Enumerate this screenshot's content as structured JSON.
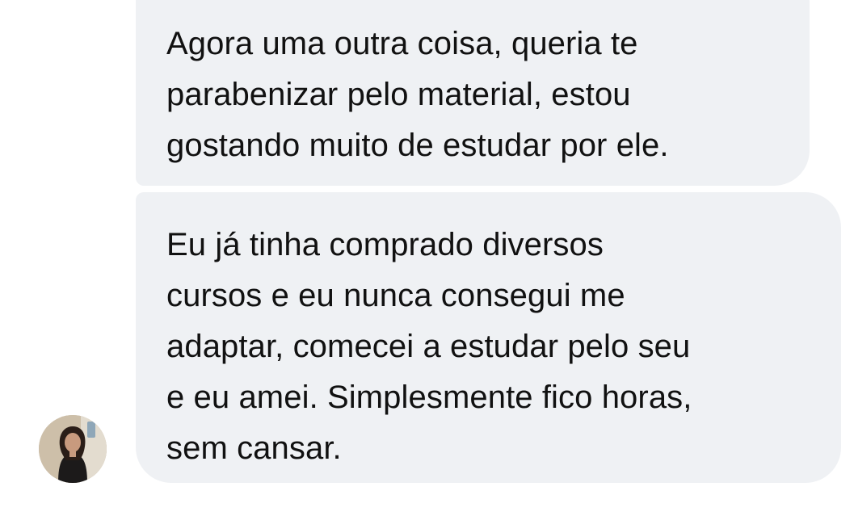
{
  "thread": {
    "messages": [
      {
        "sender": "contact",
        "text": "Agora uma outra coisa, queria te\nparabenizar pelo material, estou\ngostando muito de estudar por ele."
      },
      {
        "sender": "contact",
        "text": "Eu já tinha comprado diversos\ncursos e eu nunca consegui me\nadaptar, comecei a estudar pelo seu\ne eu amei. Simplesmente fico horas,\nsem cansar."
      }
    ],
    "avatar": {
      "icon": "profile-photo-icon"
    }
  },
  "colors": {
    "background": "#ffffff",
    "bubble": "#eff1f4",
    "text": "#111111"
  }
}
